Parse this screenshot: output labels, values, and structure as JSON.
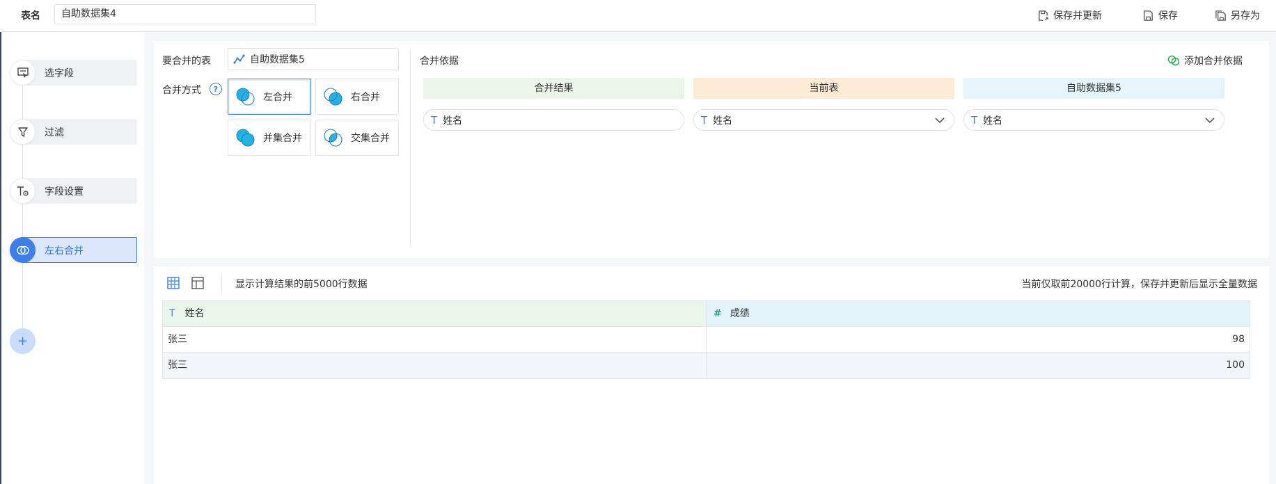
{
  "header": {
    "table_name_label": "表名",
    "table_name_value": "自助数据集4",
    "actions": {
      "save_update": "保存并更新",
      "save": "保存",
      "save_as": "另存为"
    }
  },
  "steps": [
    {
      "label": "选字段",
      "icon": "field-select-icon"
    },
    {
      "label": "过滤",
      "icon": "filter-icon"
    },
    {
      "label": "字段设置",
      "icon": "field-settings-icon"
    },
    {
      "label": "左右合并",
      "icon": "merge-icon",
      "active": true
    }
  ],
  "add_step": "+",
  "config": {
    "merge_table_label": "要合并的表",
    "merge_table_value": "自助数据集5",
    "merge_mode_label": "合并方式",
    "help": "?",
    "modes": [
      {
        "label": "左合并",
        "selected": true
      },
      {
        "label": "右合并"
      },
      {
        "label": "并集合并"
      },
      {
        "label": "交集合并"
      }
    ],
    "basis_title": "合并依据",
    "add_basis": "添加合并依据",
    "columns": {
      "result": "合并结果",
      "current": "当前表",
      "other": "自助数据集5"
    },
    "fields": {
      "result": "姓名",
      "current": "姓名",
      "other": "姓名"
    },
    "field_type_glyph": "T"
  },
  "result": {
    "info_left": "显示计算结果的前5000行数据",
    "info_right": "当前仅取前20000行计算，保存并更新后显示全量数据",
    "headers": [
      {
        "name": "姓名",
        "type_glyph": "T"
      },
      {
        "name": "成绩",
        "type_glyph": "#"
      }
    ],
    "rows": [
      [
        "张三",
        "98"
      ],
      [
        "张三",
        "100"
      ]
    ]
  },
  "colors": {
    "accent": "#3a80ef",
    "result_header_bg": "#eaf4e8",
    "current_header_bg": "#fdebd6",
    "other_header_bg": "#e5f3fb",
    "venn_fill": "#1fb3e8"
  }
}
